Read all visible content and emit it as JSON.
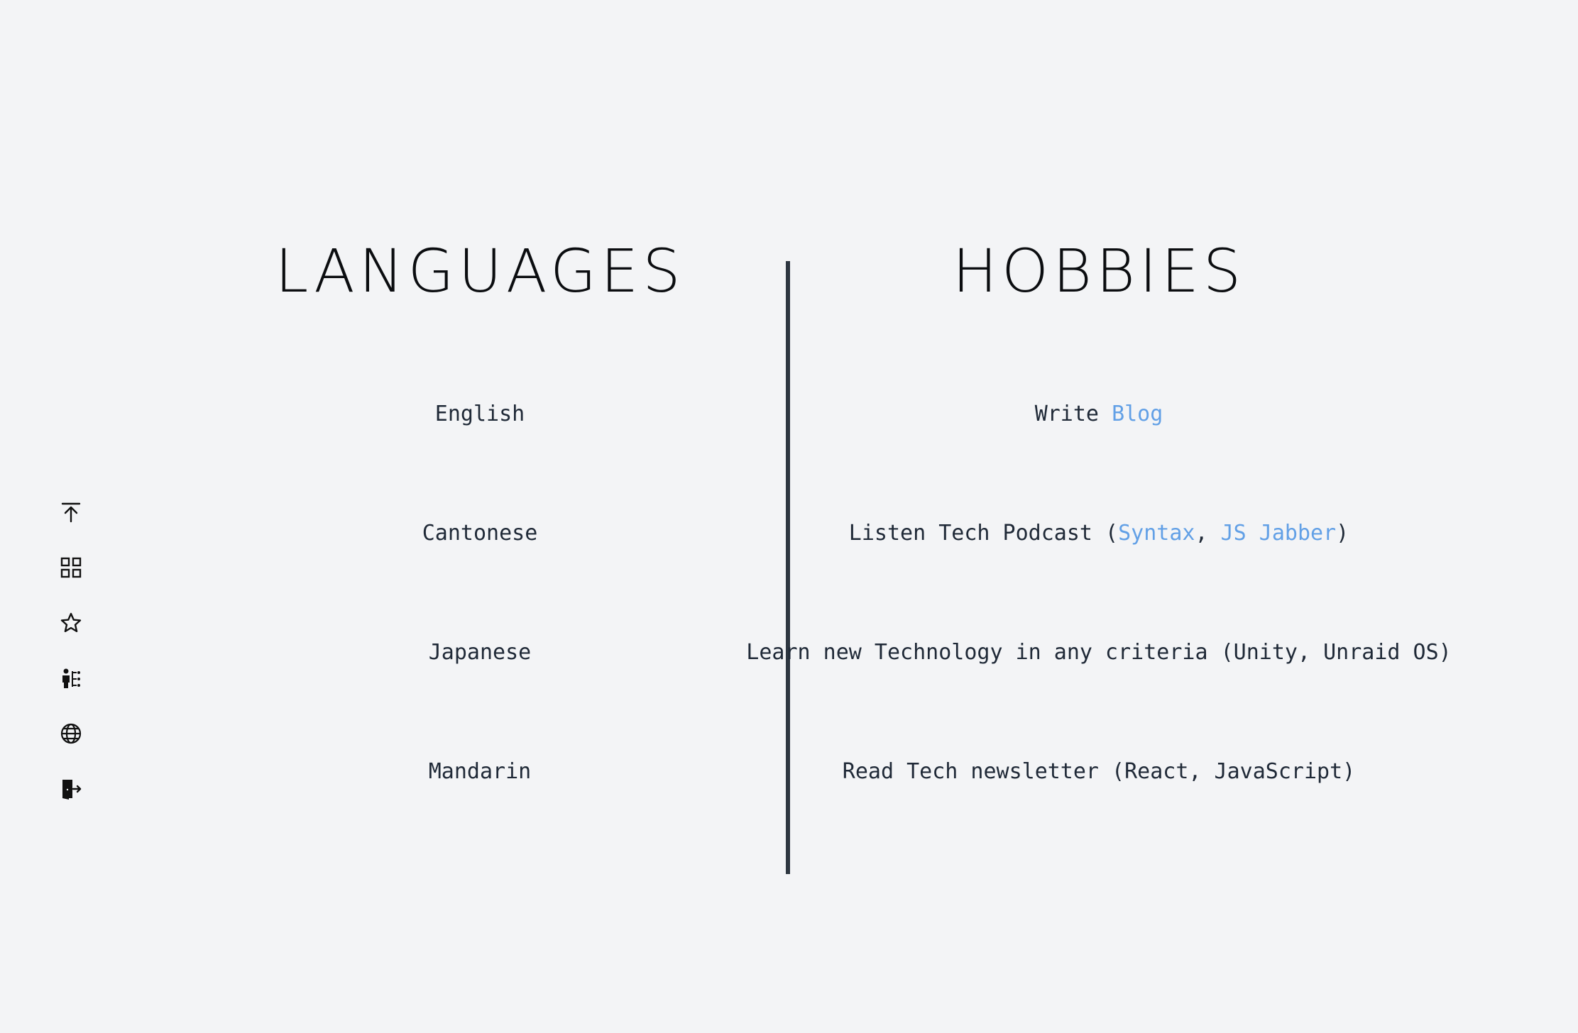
{
  "colors": {
    "background": "#f3f4f6",
    "text": "#1f2937",
    "heading": "#0b0d10",
    "link": "#62a0e6",
    "divider": "#2d3640"
  },
  "side_nav": [
    {
      "icon": "arrow-to-top-icon"
    },
    {
      "icon": "grid-icon"
    },
    {
      "icon": "star-icon"
    },
    {
      "icon": "person-skills-icon"
    },
    {
      "icon": "globe-icon"
    },
    {
      "icon": "exit-door-icon"
    }
  ],
  "languages": {
    "title": "LANGUAGES",
    "items": [
      "English",
      "Cantonese",
      "Japanese",
      "Mandarin"
    ]
  },
  "hobbies": {
    "title": "HOBBIES",
    "blog": {
      "prefix": "Write ",
      "link": "Blog"
    },
    "podcast": {
      "prefix": "Listen Tech Podcast (",
      "link1": "Syntax",
      "separator": ", ",
      "link2": "JS Jabber",
      "suffix": ")"
    },
    "learn": "Learn new Technology in any criteria (Unity, Unraid OS)",
    "read": "Read Tech newsletter (React, JavaScript)"
  }
}
